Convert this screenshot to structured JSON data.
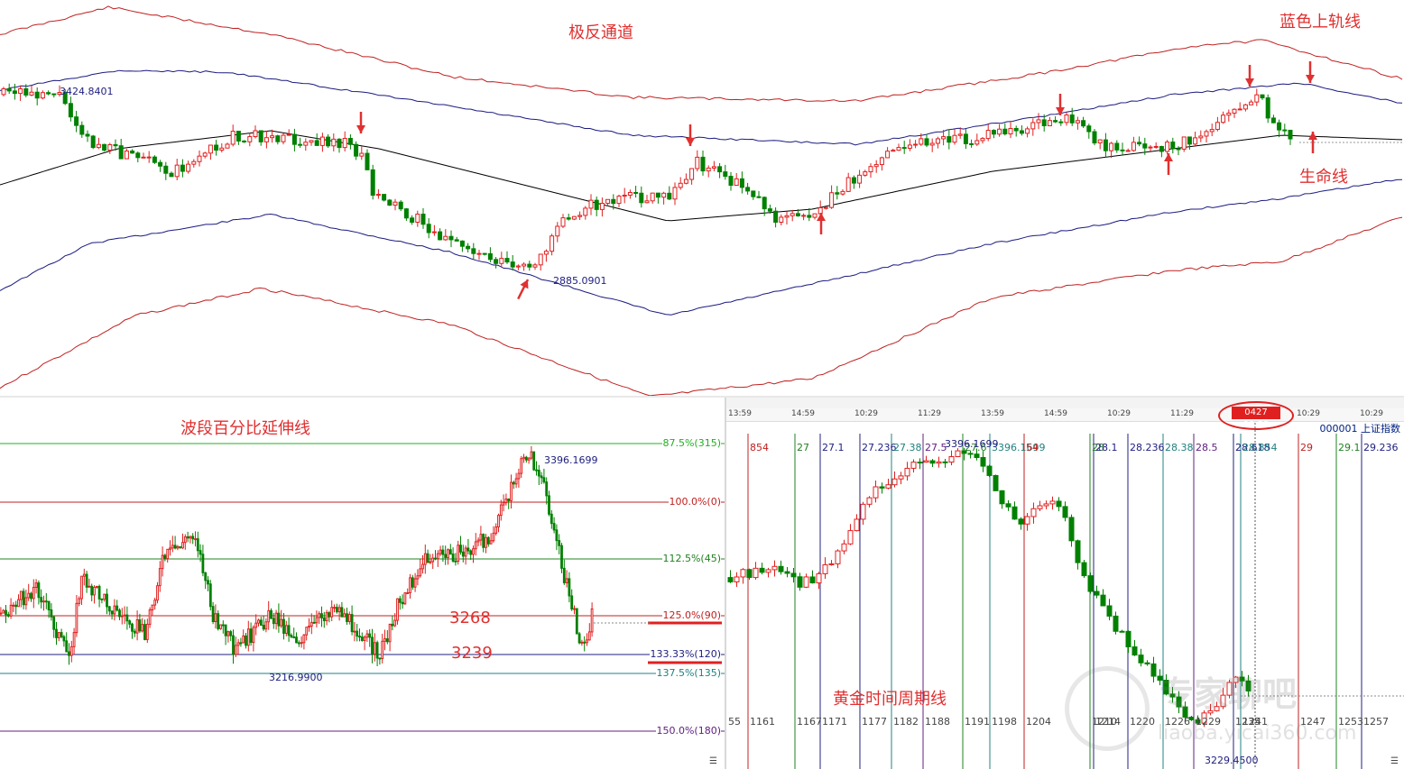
{
  "top": {
    "title": "极反通道",
    "label_upper_rail": "蓝色上轨线",
    "label_life_line": "生命线",
    "high_label": "3424.8401",
    "low_label": "2885.0901"
  },
  "left": {
    "title": "波段百分比延伸线",
    "high_label": "3396.1699",
    "low_label": "3216.9900",
    "price_a": "3268",
    "price_b": "3239",
    "levels": [
      {
        "label": "87.5%(315)",
        "color": "#20b020"
      },
      {
        "label": "100.0%(0)",
        "color": "#c02020"
      },
      {
        "label": "112.5%(45)",
        "color": "#208020"
      },
      {
        "label": "125.0%(90)",
        "color": "#c02020"
      },
      {
        "label": "133.33%(120)",
        "color": "#202080"
      },
      {
        "label": "137.5%(135)",
        "color": "#208080"
      },
      {
        "label": "150.0%(180)",
        "color": "#602080"
      }
    ]
  },
  "right": {
    "title": "黄金时间周期线",
    "stock_code": "000001  上证指数",
    "current_time": "0427 09:53",
    "high_label": "3396.1699",
    "low_label": "3229.4500",
    "time_axis": [
      "13:59",
      "14:59",
      "10:29",
      "11:29",
      "13:59",
      "14:59",
      "10:29",
      "11:29",
      "10:29",
      "10:29",
      "10:29"
    ],
    "cycle_top_labels": [
      "854",
      "27",
      "27.1",
      "27.236",
      "27.38",
      "27.5",
      "27.6",
      "3396.1699",
      "54",
      "28",
      "28.1",
      "28.236",
      "28.38",
      "28.5",
      "28.618",
      "28.854",
      "29",
      "29.1",
      "29.236"
    ],
    "cycle_bottom_labels": [
      "55",
      "1161",
      "1167",
      "1171",
      "1177",
      "1182",
      "1188",
      "1191",
      "1198",
      "1204",
      "1210",
      "1214",
      "1220",
      "1226",
      "1229",
      "1235",
      "1241",
      "1247",
      "1253",
      "1257"
    ],
    "watermark": "专家聊吧",
    "watermark_url": "liaoba.yicai360.com"
  },
  "colors": {
    "up": "#e02020",
    "down": "#008000",
    "channel_outer": "#c02020",
    "channel_mid": "#1a1a80",
    "life_line": "#000000",
    "annotation": "#e03030"
  }
}
